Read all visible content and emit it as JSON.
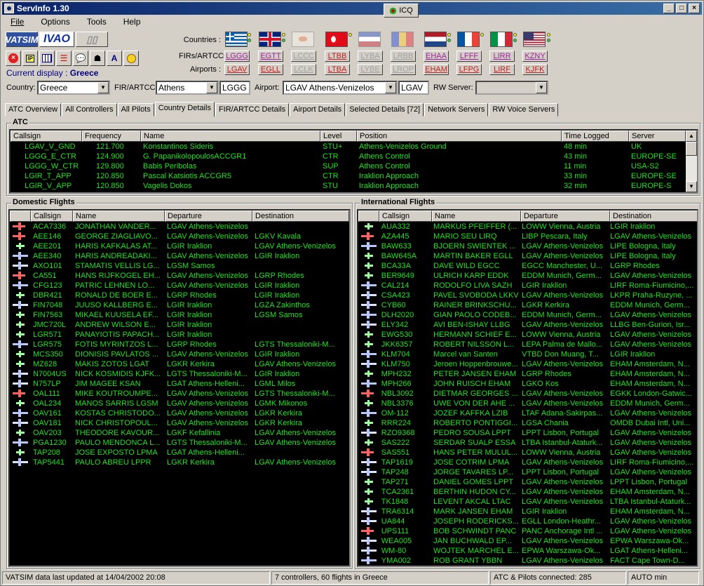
{
  "window": {
    "title": "ServInfo 1.30",
    "icq_label": "ICQ"
  },
  "menu": [
    "File",
    "Options",
    "Tools",
    "Help"
  ],
  "logos": {
    "vatsim": "VATSIM",
    "ivao": "IVAO"
  },
  "current_display": {
    "label": "Current display :",
    "value": "Greece"
  },
  "row_labels": {
    "countries": "Countries :",
    "firs": "FIRs/ARTCCs:",
    "airports": "Airports :"
  },
  "firs": [
    "LGGG",
    "EGTT",
    "LCCC",
    "LTBB",
    "LYBA",
    "LRBB",
    "EHAA",
    "LFFF",
    "LIRR",
    "KZNY"
  ],
  "airports": [
    "LGAV",
    "EGLL",
    "LCLK",
    "LTBA",
    "LYBE",
    "LROP",
    "EHAM",
    "LFPG",
    "LIRF",
    "KJFK"
  ],
  "filters": {
    "country_label": "Country:",
    "country": "Greece",
    "fir_label": "FIR/ARTCC:",
    "fir": "Athens",
    "fir_code": "LGGG",
    "airport_label": "Airport:",
    "airport": "LGAV Athens-Venizelos",
    "airport_code": "LGAV",
    "rw_label": "RW Server:",
    "rw": ""
  },
  "tabs": [
    "ATC Overview",
    "All Controllers",
    "All Pilots",
    "Country Details",
    "FIR/ARTCC Details",
    "Airport Details",
    "Selected Details [72]",
    "Network Servers",
    "RW Voice Servers"
  ],
  "atc": {
    "title": "ATC",
    "headers": [
      "Callsign",
      "Frequency",
      "Name",
      "Level",
      "Position",
      "Time Logged",
      "Server"
    ],
    "rows": [
      [
        "LGAV_V_GND",
        "121.700",
        "Konstantinos Sideris",
        "STU+",
        "Athens-Venizelos Ground",
        "48 min",
        "UK"
      ],
      [
        "LGGG_E_CTR",
        "124.900",
        "G. PapanikolopoulosACCGR1",
        "CTR",
        "Athens Control",
        "43 min",
        "EUROPE-SE"
      ],
      [
        "LGGG_W_CTR",
        "129.800",
        "Babis Peribolas",
        "SUP",
        "Athens Control",
        "11 min",
        "USA-S2"
      ],
      [
        "LGIR_T_APP",
        "120.850",
        "Pascal Katsiotis ACCGR5",
        "CTR",
        "Iraklion Approach",
        "33 min",
        "EUROPE-SE"
      ],
      [
        "LGIR_V_APP",
        "120.850",
        "Vagelis Dokos",
        "STU",
        "Iraklion Approach",
        "32 min",
        "EUROPE-S"
      ]
    ]
  },
  "domestic": {
    "title": "Domestic Flights",
    "headers": [
      "Callsign",
      "Name",
      "Departure",
      "Destination"
    ],
    "rows": [
      [
        "ACA7336",
        "JONATHAN VANDER...",
        "LGAV Athens-Venizelos",
        ""
      ],
      [
        "AEE146",
        "GEORGE ZIAGLIAVO...",
        "LGAV Athens-Venizelos",
        "LGKV Kavala"
      ],
      [
        "AEE201",
        "HARIS KAFKALAS AT...",
        "LGIR Iraklion",
        "LGAV Athens-Venizelos"
      ],
      [
        "AEE340",
        "HARIS ANDREADAKI...",
        "LGAV Athens-Venizelos",
        "LGIR Iraklion"
      ],
      [
        "AXO101",
        "STAMATIS VELLIS LG...",
        "LGSM Samos",
        ""
      ],
      [
        "CA551",
        "HANS RIJFKOGEL EH...",
        "LGAV Athens-Venizelos",
        "LGRP Rhodes"
      ],
      [
        "CFG123",
        "PATRIC LEHNEN LO...",
        "LGAV Athens-Venizelos",
        "LGIR Iraklion"
      ],
      [
        "DBR421",
        "RONALD DE BOER E...",
        "LGRP Rhodes",
        "LGIR Iraklion"
      ],
      [
        "FIN7048",
        "JUUSO KALLBERG E...",
        "LGIR Iraklion",
        "LGZA Zakinthos"
      ],
      [
        "FIN7563",
        "MIKAEL KUUSELA EF...",
        "LGIR Iraklion",
        "LGSM Samos"
      ],
      [
        "JMC720L",
        "ANDREW WILSON E...",
        "LGIR Iraklion",
        ""
      ],
      [
        "LGR571",
        "PANAYIOTIS PAPACH...",
        "LGIR Iraklion",
        ""
      ],
      [
        "LGR575",
        "FOTIS MYRINTZOS L...",
        "LGRP Rhodes",
        "LGTS Thessaloniki-M..."
      ],
      [
        "MCS350",
        "DIONISIS PAVLATOS ...",
        "LGAV Athens-Venizelos",
        "LGIR Iraklion"
      ],
      [
        "MZ628",
        "MAKIS ZOTOS LGAT",
        "LGKR Kerkira",
        "LGAV Athens-Venizelos"
      ],
      [
        "N7004US",
        "NICK KOSMIDIS KJFK...",
        "LGTS Thessaloniki-M...",
        "LGIR Iraklion"
      ],
      [
        "N757LP",
        "JIM MAGEE KSAN",
        "LGAT Athens-Helleni...",
        "LGML Milos"
      ],
      [
        "OAL111",
        "MIKE KOUTROUMPE...",
        "LGAV Athens-Venizelos",
        "LGTS Thessaloniki-M..."
      ],
      [
        "OAL234",
        "MANOS SARRIS LGSM",
        "LGAV Athens-Venizelos",
        "LGMK Mikonos"
      ],
      [
        "OAV161",
        "KOSTAS CHRISTODO...",
        "LGAV Athens-Venizelos",
        "LGKR Kerkira"
      ],
      [
        "OAV181",
        "NICK CHRISTOPOUL...",
        "LGAV Athens-Venizelos",
        "LGKR Kerkira"
      ],
      [
        "OAV203",
        "THEODORE KAVOUR...",
        "LGKF Kefallinia",
        "LGAV Athens-Venizelos"
      ],
      [
        "PGA1230",
        "PAULO MENDONCA L...",
        "LGTS Thessaloniki-M...",
        "LGAV Athens-Venizelos"
      ],
      [
        "TAP208",
        "JOSE EXPOSTO LPMA",
        "LGAT Athens-Helleni...",
        ""
      ],
      [
        "TAP5441",
        "PAULO ABREU LPPR",
        "LGKR Kerkira",
        "LGAV Athens-Venizelos"
      ]
    ]
  },
  "international": {
    "title": "International Flights",
    "headers": [
      "Callsign",
      "Name",
      "Departure",
      "Destination"
    ],
    "rows": [
      [
        "AUA332",
        "MARKUS PFEIFFER (...",
        "LOWW Vienna, Austria",
        "LGIR Iraklion"
      ],
      [
        "AZA445",
        "MARIO SEU LIRQ",
        "LIBP Pescara, Italy",
        "LGAV Athens-Venizelos"
      ],
      [
        "BAW633",
        "BJOERN SWIENTEK ...",
        "LGAV Athens-Venizelos",
        "LIPE Bologna, Italy"
      ],
      [
        "BAW645A",
        "MARTIN BAKER EGLL",
        "LGAV Athens-Venizelos",
        "LIPE Bologna, Italy"
      ],
      [
        "BCA33A",
        "DAVE WILD EGCC",
        "EGCC Manchester, U...",
        "LGRP Rhodes"
      ],
      [
        "BER9649",
        "ULRICH KARP EDDK",
        "EDDM Munich, Germ...",
        "LGAV Athens-Venizelos"
      ],
      [
        "CAL214",
        "RODOLFO LIVA SAZH",
        "LGIR Iraklion",
        "LIRF Roma-Fiumicino,..."
      ],
      [
        "CSA423",
        "PAVEL SVOBODA LKKV",
        "LGAV Athens-Venizelos",
        "LKPR Praha-Ruzyne, ..."
      ],
      [
        "CYB60",
        "RAINER BRINKSCHU...",
        "LGKR Kerkira",
        "EDDM Munich, Germ..."
      ],
      [
        "DLH2020",
        "GIAN PAOLO CODEB...",
        "EDDM Munich, Germ...",
        "LGAV Athens-Venizelos"
      ],
      [
        "ELY342",
        "AVI BEN-ISHAY LLBG",
        "LGAV Athens-Venizelos",
        "LLBG Ben-Gurion, Isr..."
      ],
      [
        "EWG530",
        "HERMANN SCHIEF E...",
        "LOWW Vienna, Austria",
        "LGAV Athens-Venizelos"
      ],
      [
        "JKK6357",
        "ROBERT NILSSON L...",
        "LEPA Palma de Mallo...",
        "LGAV Athens-Venizelos"
      ],
      [
        "KLM704",
        "Marcel van Santen",
        "VTBD Don Muang, T...",
        "LGIR Iraklion"
      ],
      [
        "KLM750",
        "Jeroen Hoppenbrouwe...",
        "LGAV Athens-Venizelos",
        "EHAM Amsterdam, N..."
      ],
      [
        "MPH232",
        "PETER JANSEN EHAM",
        "LGRP Rhodes",
        "EHAM Amsterdam, N..."
      ],
      [
        "MPH266",
        "JOHN RUISCH EHAM",
        "LGKO Kos",
        "EHAM Amsterdam, N..."
      ],
      [
        "NBL3092",
        "DIETMAR GEORGES ...",
        "LGAV Athens-Venizelos",
        "EGKK London-Gatwic..."
      ],
      [
        "NBL3376",
        "UWE VON DER AHE ...",
        "LGAV Athens-Venizelos",
        "EDDM Munich, Germ..."
      ],
      [
        "OM-112",
        "JOZEF KAFFKA LZIB",
        "LTAF Adana-Sakirpas...",
        "LGAV Athens-Venizelos"
      ],
      [
        "RRR224",
        "ROBERTO PONTIGGI...",
        "LGSA Chania",
        "OMDB Dubai Intl, Uni..."
      ],
      [
        "RZO9368",
        "PEDRO SOUSA LPPT",
        "LPPT Lisbon, Portugal",
        "LGAV Athens-Venizelos"
      ],
      [
        "SAS222",
        "SERDAR SUALP ESSA",
        "LTBA Istanbul-Ataturk...",
        "LGAV Athens-Venizelos"
      ],
      [
        "SAS551",
        "HANS PETER MULUL...",
        "LOWW Vienna, Austria",
        "LGAV Athens-Venizelos"
      ],
      [
        "TAP1619",
        "JOSE COTRIM LPMA",
        "LGAV Athens-Venizelos",
        "LIRF Roma-Fiumicino,..."
      ],
      [
        "TAP248",
        "JORGE TAVARES LP...",
        "LPPT Lisbon, Portugal",
        "LGAV Athens-Venizelos"
      ],
      [
        "TAP271",
        "DANIEL GOMES LPPT",
        "LGAV Athens-Venizelos",
        "LPPT Lisbon, Portugal"
      ],
      [
        "TCA2361",
        "BERTHIN HUDON CY...",
        "LGAV Athens-Venizelos",
        "EHAM Amsterdam, N..."
      ],
      [
        "TK1848",
        "LEVENT AKCAL LTAC",
        "LGAV Athens-Venizelos",
        "LTBA Istanbul-Ataturk..."
      ],
      [
        "TRA6314",
        "MARK JANSEN EHAM",
        "LGIR Iraklion",
        "EHAM Amsterdam, N..."
      ],
      [
        "UA844",
        "JOSEPH RODERICKS...",
        "EGLL London-Heathr...",
        "LGAV Athens-Venizelos"
      ],
      [
        "UPS111",
        "BOB SCHWINDT PANC",
        "PANC Anchorage Intl ...",
        "LGAV Athens-Venizelos"
      ],
      [
        "WEA005",
        "JAN BUCHWALD EP...",
        "LGAV Athens-Venizelos",
        "EPWA Warszawa-Ok..."
      ],
      [
        "WM-80",
        "WOJTEK MARCHEL E...",
        "EPWA Warszawa-Ok...",
        "LGAT Athens-Helleni..."
      ],
      [
        "YMA002",
        "ROB GRANT YBBN",
        "LGAV Athens-Venizelos",
        "FACT Cape Town-D..."
      ]
    ]
  },
  "status": [
    "VATSIM data last updated at 14/04/2002 20:08",
    "7 controllers, 60 flights in Greece",
    "ATC & Pilots connected: 285",
    "AUTO min"
  ],
  "colors": {
    "grid_bg": "#000000",
    "grid_text": "#20e020",
    "title_bar": "#0a246a"
  }
}
